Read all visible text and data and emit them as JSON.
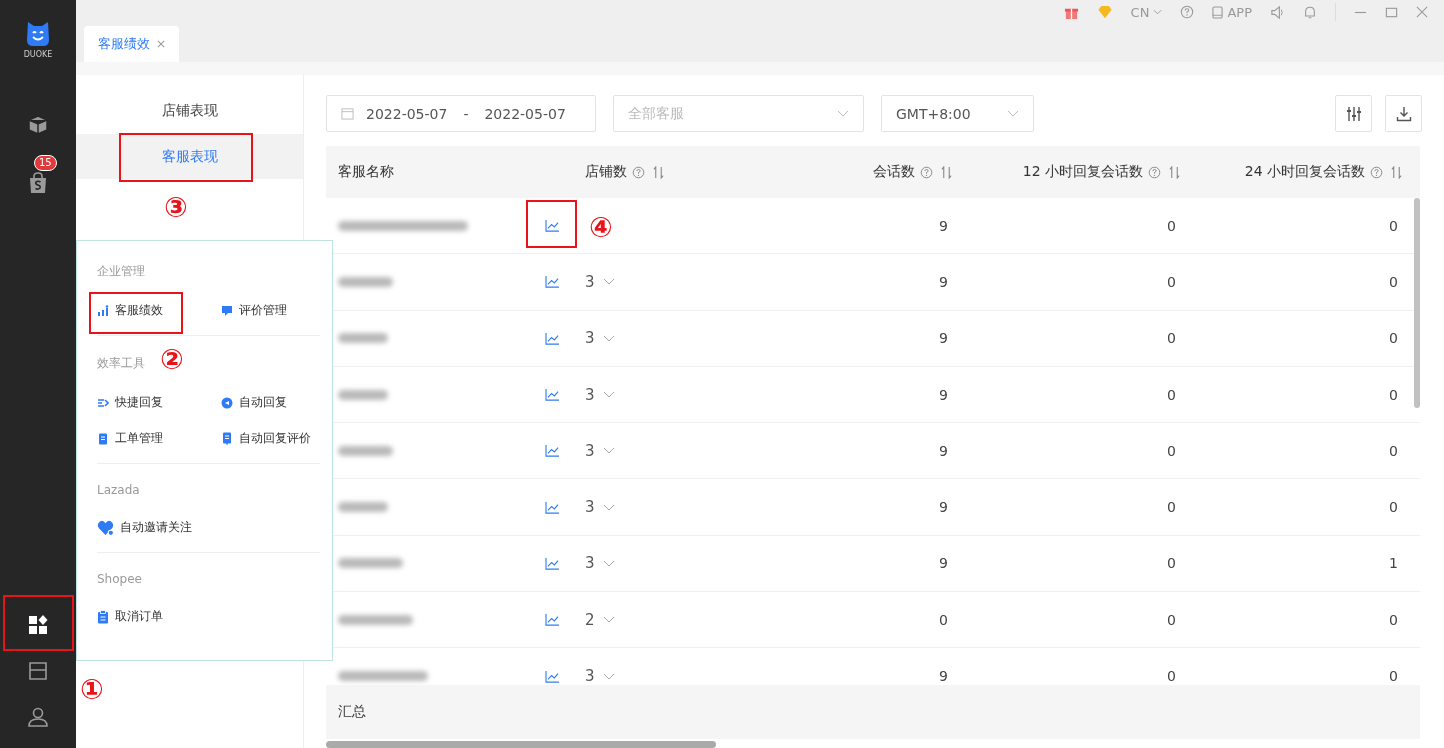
{
  "logo": {
    "text": "DUOKE"
  },
  "rail_top": [
    {
      "kind": "box",
      "selected": false
    },
    {
      "kind": "shop",
      "badge": "15",
      "selected": false
    }
  ],
  "rail_bottom": [
    {
      "kind": "apps",
      "selected": true
    },
    {
      "kind": "store",
      "selected": false
    },
    {
      "kind": "user",
      "selected": false
    }
  ],
  "topbar": {
    "language": "CN",
    "app_label": "APP"
  },
  "tabs": [
    {
      "label": "客服绩效",
      "selected": true
    }
  ],
  "subnav": [
    {
      "label": "店铺表现",
      "selected": false
    },
    {
      "label": "客服表现",
      "selected": true
    }
  ],
  "filters": {
    "date_start": "2022-05-07",
    "date_separator": "-",
    "date_end": "2022-05-07",
    "staff_placeholder": "全部客服",
    "timezone": "GMT+8:00"
  },
  "table": {
    "columns": [
      {
        "label": "客服名称"
      },
      {
        "label": "店铺数",
        "help": true,
        "sortable": true
      },
      {
        "label": "会话数",
        "help": true,
        "sortable": true
      },
      {
        "label": "12 小时回复会话数",
        "help": true,
        "sortable": true
      },
      {
        "label": "24 小时回复会话数",
        "help": true,
        "sortable": true
      }
    ],
    "rows": [
      {
        "sessions": "9",
        "reply_12h": "0",
        "reply_24h": "0"
      },
      {
        "stores": "3",
        "sessions": "9",
        "reply_12h": "0",
        "reply_24h": "0"
      },
      {
        "stores": "3",
        "sessions": "9",
        "reply_12h": "0",
        "reply_24h": "0"
      },
      {
        "stores": "3",
        "sessions": "9",
        "reply_12h": "0",
        "reply_24h": "0"
      },
      {
        "stores": "3",
        "sessions": "9",
        "reply_12h": "0",
        "reply_24h": "0"
      },
      {
        "stores": "3",
        "sessions": "9",
        "reply_12h": "0",
        "reply_24h": "0"
      },
      {
        "stores": "3",
        "sessions": "9",
        "reply_12h": "0",
        "reply_24h": "1"
      },
      {
        "stores": "2",
        "sessions": "0",
        "reply_12h": "0",
        "reply_24h": "0"
      },
      {
        "stores": "3",
        "sessions": "9",
        "reply_12h": "0",
        "reply_24h": "0"
      }
    ],
    "summary_label": "汇总"
  },
  "menu": {
    "sections": [
      {
        "title": "企业管理",
        "items": [
          {
            "label": "客服绩效",
            "kind": "chart"
          },
          {
            "label": "评价管理",
            "kind": "comment"
          }
        ]
      },
      {
        "title": "效率工具",
        "items": [
          {
            "label": "快捷回复",
            "kind": "quick"
          },
          {
            "label": "自动回复",
            "kind": "bubble"
          },
          {
            "label": "工单管理",
            "kind": "doc"
          },
          {
            "label": "自动回复评价",
            "kind": "doc2"
          }
        ]
      },
      {
        "title": "Lazada",
        "items": [
          {
            "label": "自动邀请关注",
            "kind": "heart"
          }
        ]
      },
      {
        "title": "Shopee",
        "items": [
          {
            "label": "取消订单",
            "kind": "clipboard"
          }
        ]
      }
    ]
  },
  "annotations": [
    {
      "label": "③"
    },
    {
      "label": "②"
    },
    {
      "label": "④"
    },
    {
      "label": "①"
    }
  ]
}
